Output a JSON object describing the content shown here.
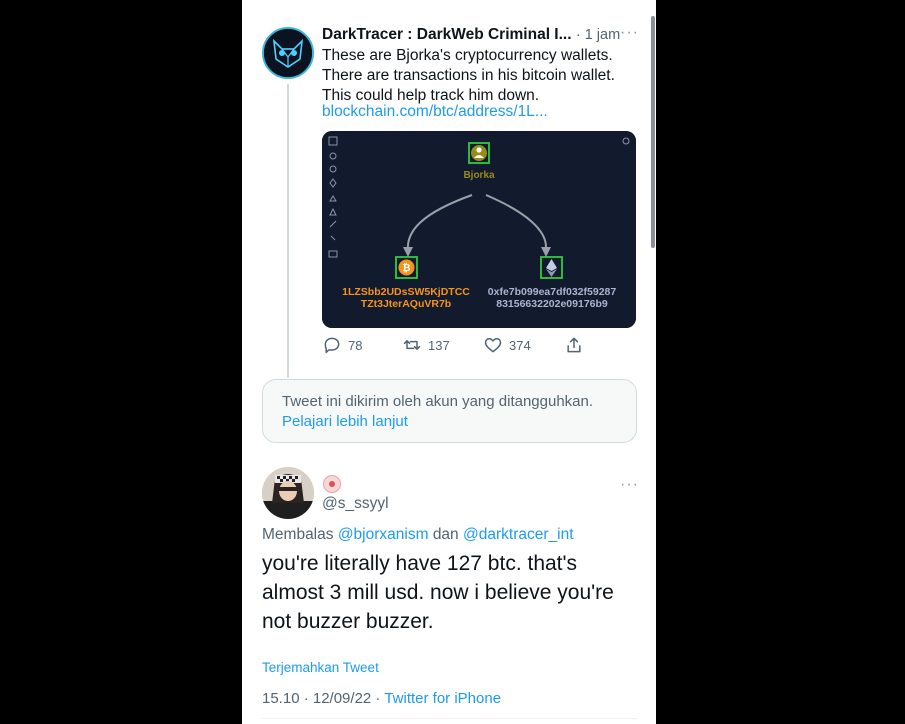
{
  "tweet1": {
    "name": "DarkTracer : DarkWeb Criminal I...",
    "time": "· 1 jam",
    "more": "···",
    "lines": [
      "These are Bjorka's cryptocurrency wallets.",
      "There are transactions in his bitcoin wallet.",
      "This could help track him down."
    ],
    "link": "blockchain.com/btc/address/1L...",
    "graph": {
      "node_label": "Bjorka",
      "btc_address_line1": "1LZSbb2UDsSW5KjDTCC",
      "btc_address_line2": "TZt3JterAQuVR7b",
      "eth_address_line1": "0xfe7b099ea7df032f59287",
      "eth_address_line2": "83156632202e09176b9",
      "colors": {
        "background": "#121b2e",
        "node_border": "#2ecc40",
        "person": "#9a8a1a",
        "btc": "#f7931a",
        "btc_text": "#f7931a",
        "eth_text": "#aab3d0"
      }
    },
    "actions": {
      "replies": "78",
      "retweets": "137",
      "likes": "374"
    }
  },
  "notice": {
    "text": "Tweet ini dikirim oleh akun yang ditangguhkan.",
    "link": "Pelajari lebih lanjut"
  },
  "tweet2": {
    "handle": "@s_ssyyl",
    "more": "···",
    "replying_prefix": "Membalas",
    "mention1": "@bjorxanism",
    "connector": "dan",
    "mention2": "@darktracer_int",
    "body": "you're literally have 127 btc. that's almost 3 mill usd. now i believe you're not buzzer buzzer.",
    "translate": "Terjemahkan Tweet",
    "timestamp": "15.10 · 12/09/22 · ",
    "source": "Twitter for iPhone"
  }
}
